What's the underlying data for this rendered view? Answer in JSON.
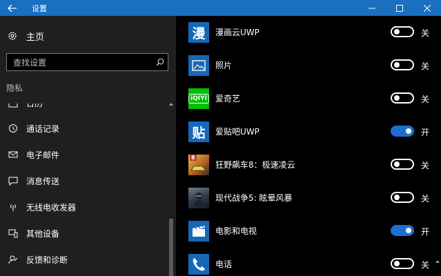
{
  "window": {
    "title": "设置"
  },
  "sidebar": {
    "home_label": "主页",
    "search_placeholder": "查找设置",
    "section_title": "隐私",
    "items": [
      {
        "label": "日历"
      },
      {
        "label": "通话记录"
      },
      {
        "label": "电子邮件"
      },
      {
        "label": "消息传送"
      },
      {
        "label": "无线电收发器"
      },
      {
        "label": "其他设备"
      },
      {
        "label": "反馈和诊断"
      }
    ]
  },
  "apps": [
    {
      "name": "漫画云UWP",
      "icon_text": "漫",
      "icon_color": "#1767b8",
      "state": "关",
      "on": false
    },
    {
      "name": "照片",
      "icon_text": "",
      "icon_color": "#1767b8",
      "state": "关",
      "on": false
    },
    {
      "name": "爱奇艺",
      "icon_text": "iQIYI",
      "icon_color": "#00be06",
      "state": "关",
      "on": false
    },
    {
      "name": "爱贴吧UWP",
      "icon_text": "贴",
      "icon_color": "#1767b8",
      "state": "开",
      "on": true
    },
    {
      "name": "狂野飙车8：极速凌云",
      "icon_text": "8",
      "icon_color": "#c9a33a",
      "state": "关",
      "on": false
    },
    {
      "name": "现代战争5: 眩晕风暴",
      "icon_text": "",
      "icon_color": "#3a4a58",
      "state": "关",
      "on": false
    },
    {
      "name": "电影和电视",
      "icon_text": "",
      "icon_color": "#1767b8",
      "state": "开",
      "on": true
    },
    {
      "name": "电话",
      "icon_text": "",
      "icon_color": "#1767b8",
      "state": "关",
      "on": false
    }
  ],
  "colors": {
    "titlebar": "#1a6fc0",
    "accent": "#1b6fd0",
    "sidebar_bg": "#1f1f1f"
  },
  "icons": {
    "back": "back-arrow-icon",
    "home": "gear-icon",
    "search": "search-icon"
  }
}
